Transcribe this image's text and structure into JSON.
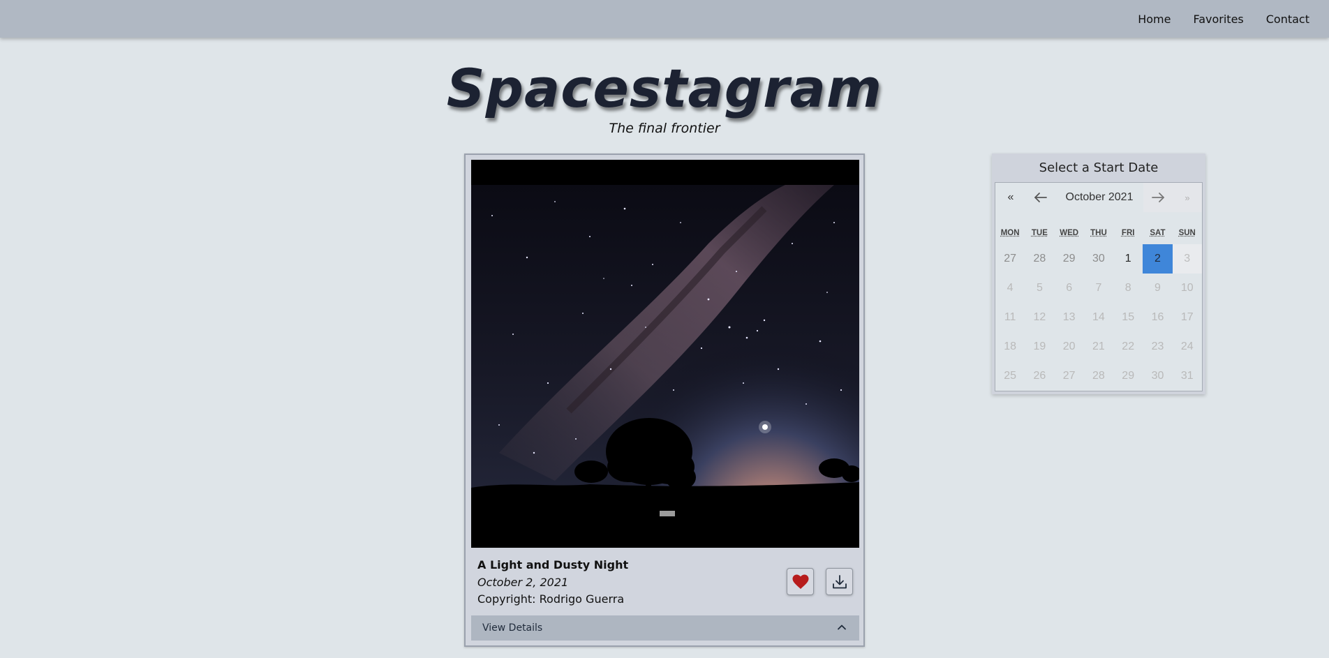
{
  "nav": {
    "links": [
      "Home",
      "Favorites",
      "Contact"
    ]
  },
  "header": {
    "title": "Spacestagram",
    "subtitle": "The final frontier"
  },
  "post": {
    "title": "A Light and Dusty Night",
    "date": "October 2, 2021",
    "copyright": "Copyright: Rodrigo Guerra",
    "details_label": "View Details",
    "liked": true
  },
  "calendar": {
    "heading": "Select a Start Date",
    "prev_year": "«",
    "next_year": "»",
    "month_label": "October 2021",
    "weekdays": [
      "MON",
      "TUE",
      "WED",
      "THU",
      "FRI",
      "SAT",
      "SUN"
    ],
    "weeks": [
      [
        "27",
        "28",
        "29",
        "30",
        "1",
        "2",
        "3"
      ],
      [
        "4",
        "5",
        "6",
        "7",
        "8",
        "9",
        "10"
      ],
      [
        "11",
        "12",
        "13",
        "14",
        "15",
        "16",
        "17"
      ],
      [
        "18",
        "19",
        "20",
        "21",
        "22",
        "23",
        "24"
      ],
      [
        "25",
        "26",
        "27",
        "28",
        "29",
        "30",
        "31"
      ]
    ],
    "selected_day": "2"
  },
  "colors": {
    "navbar": "#b0b8c3",
    "background": "#dfe5e9",
    "selected_day": "#3f86d9",
    "heart": "#b71c1c"
  }
}
